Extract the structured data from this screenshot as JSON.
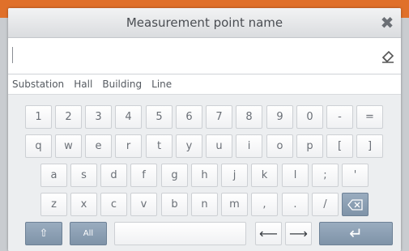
{
  "dialog": {
    "title": "Measurement point name",
    "close_icon": "close-x-icon"
  },
  "input": {
    "value": "",
    "clear_icon": "eraser-icon"
  },
  "suggestions": [
    "Substation",
    "Hall",
    "Building",
    "Line"
  ],
  "keyboard": {
    "row1": [
      "1",
      "2",
      "3",
      "4",
      "5",
      "6",
      "7",
      "8",
      "9",
      "0",
      "-",
      "="
    ],
    "row2": [
      "q",
      "w",
      "e",
      "r",
      "t",
      "y",
      "u",
      "i",
      "o",
      "p",
      "[",
      "]"
    ],
    "row3": [
      "a",
      "s",
      "d",
      "f",
      "g",
      "h",
      "j",
      "k",
      "l",
      ";",
      "'"
    ],
    "row4": [
      "z",
      "x",
      "c",
      "v",
      "b",
      "n",
      "m",
      ",",
      ".",
      "/"
    ],
    "backspace_icon": "backspace-icon",
    "shift_glyph": "⇧",
    "all_label": "All",
    "left_arrow": "⟵",
    "right_arrow": "⟶",
    "enter_glyph": "↵"
  },
  "colors": {
    "accent_bar": "#e0702a",
    "dark_key": "#8a9db1"
  }
}
